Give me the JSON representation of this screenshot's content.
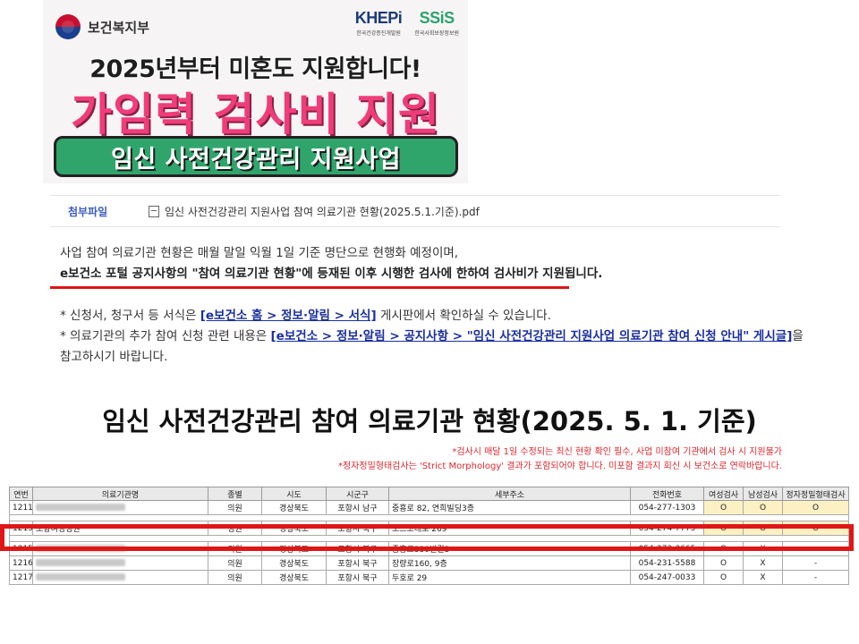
{
  "banner": {
    "gov_name": "보건복지부",
    "partner1_main": "KHEPi",
    "partner1_sub": "한국건강증진개발원",
    "partner2_main": "SSiS",
    "partner2_sub": "한국사회보장정보원",
    "headline": "2025년부터 미혼도 지원합니다!",
    "big_title": "가임력 검사비 지원",
    "program": "임신 사전건강관리 지원사업"
  },
  "attachment": {
    "label": "첨부파일",
    "filename": "임신 사전건강관리 지원사업 참여 의료기관 현황(2025.5.1.기준).pdf"
  },
  "notice": {
    "line1": "사업 참여 의료기관 현황은 매월 말일 익월 1일 기준 명단으로 현행화 예정이며,",
    "line2": "e보건소 포털 공지사항의 \"참여 의료기관 현황\"에 등재된 이후 시행한 검사에 한하여 검사비가 지원됩니다."
  },
  "links": {
    "l1_pre": "* 신청서, 청구서 등 서식은 ",
    "l1_link": "[e보건소 홈 > 정보·알림 > 서식]",
    "l1_post": " 게시판에서 확인하실 수 있습니다.",
    "l2_pre": "* 의료기관의 추가 참여 신청 관련 내용은 ",
    "l2_link": "[e보건소 > 정보·알림 > 공지사항 > \"임신 사전건강관리 지원사업 의료기관 참여 신청 안내\" 게시글]",
    "l2_post": "을",
    "l3": "참고하시기 바랍니다."
  },
  "table_section": {
    "title": "임신 사전건강관리 참여 의료기관 현황(2025. 5. 1. 기준)",
    "note1": "*검사시 매달 1일 수정되는 최신 현황 확인 필수, 사업 미참여 기관에서 검사 시 지원불가",
    "note2": "*정자정밀형태검사는 'Strict Morphology' 결과가 포함되어야 합니다. 미포함 결과지 회신 시 보건소로 연락바랍니다.",
    "headers": [
      "연번",
      "의료기관명",
      "종별",
      "시도",
      "시군구",
      "세부주소",
      "전화번호",
      "여성검사",
      "남성검사",
      "정자정밀형태검사"
    ],
    "rows": [
      {
        "no": "1211",
        "name": "",
        "type": "의원",
        "sido": "경상북도",
        "sigungu": "포항시 남구",
        "addr": "중흥로 82, 연희빌딩3층",
        "tel": "054-277-1303",
        "f": "O",
        "m": "O",
        "s": "O"
      },
      {
        "no": "1213",
        "name": "포항여성병원",
        "type": "병원",
        "sido": "경상북도",
        "sigungu": "포항시 북구",
        "addr": "포스코대로 269",
        "tel": "054-274-7775",
        "f": "O",
        "m": "O",
        "s": "O"
      },
      {
        "no": "1215",
        "name": "",
        "type": "의원",
        "sido": "경상북도",
        "sigungu": "포항시 북구",
        "addr": "중흥로330번길3",
        "tel": "054-273-3665",
        "f": "O",
        "m": "X",
        "s": "-"
      },
      {
        "no": "1216",
        "name": "",
        "type": "의원",
        "sido": "경상북도",
        "sigungu": "포항시 북구",
        "addr": "장량로160, 9층",
        "tel": "054-231-5588",
        "f": "O",
        "m": "X",
        "s": "-"
      },
      {
        "no": "1217",
        "name": "",
        "type": "의원",
        "sido": "경상북도",
        "sigungu": "포항시 북구",
        "addr": "두호로 29",
        "tel": "054-247-0033",
        "f": "O",
        "m": "X",
        "s": "-"
      }
    ]
  }
}
